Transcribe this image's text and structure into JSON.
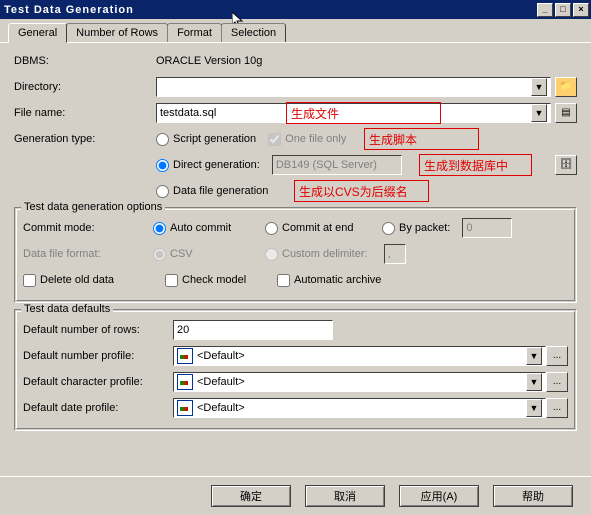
{
  "window": {
    "title": "Test Data Generation"
  },
  "tabs": [
    "General",
    "Number of Rows",
    "Format",
    "Selection"
  ],
  "general": {
    "dbms_label": "DBMS:",
    "dbms_value": "ORACLE Version 10g",
    "directory_label": "Directory:",
    "directory_value": "",
    "filename_label": "File name:",
    "filename_value": "testdata.sql",
    "gentype_label": "Generation type:",
    "script_gen": "Script generation",
    "one_file": "One file only",
    "direct_gen": "Direct generation:",
    "direct_value": "DB149 (SQL Server)",
    "data_file_gen": "Data file generation"
  },
  "options": {
    "group": "Test data generation options",
    "commit_mode": "Commit mode:",
    "auto_commit": "Auto commit",
    "commit_end": "Commit at end",
    "by_packet": "By packet:",
    "by_packet_val": "0",
    "data_file_format": "Data file format:",
    "csv": "CSV",
    "custom_delim": "Custom delimiter:",
    "custom_delim_val": ",",
    "delete_old": "Delete old data",
    "check_model": "Check model",
    "auto_archive": "Automatic archive"
  },
  "defaults": {
    "group": "Test data defaults",
    "rows_label": "Default number of rows:",
    "rows_value": "20",
    "num_profile": "Default number profile:",
    "char_profile": "Default character profile:",
    "date_profile": "Default date profile:",
    "default_text": "<Default>"
  },
  "annotations": {
    "gen_file": "生成文件",
    "gen_script": "生成脚本",
    "gen_db": "生成到数据库中",
    "gen_cvs": "生成以CVS为后缀名"
  },
  "buttons": {
    "ok": "确定",
    "cancel": "取消",
    "apply": "应用(A)",
    "help": "帮助"
  }
}
